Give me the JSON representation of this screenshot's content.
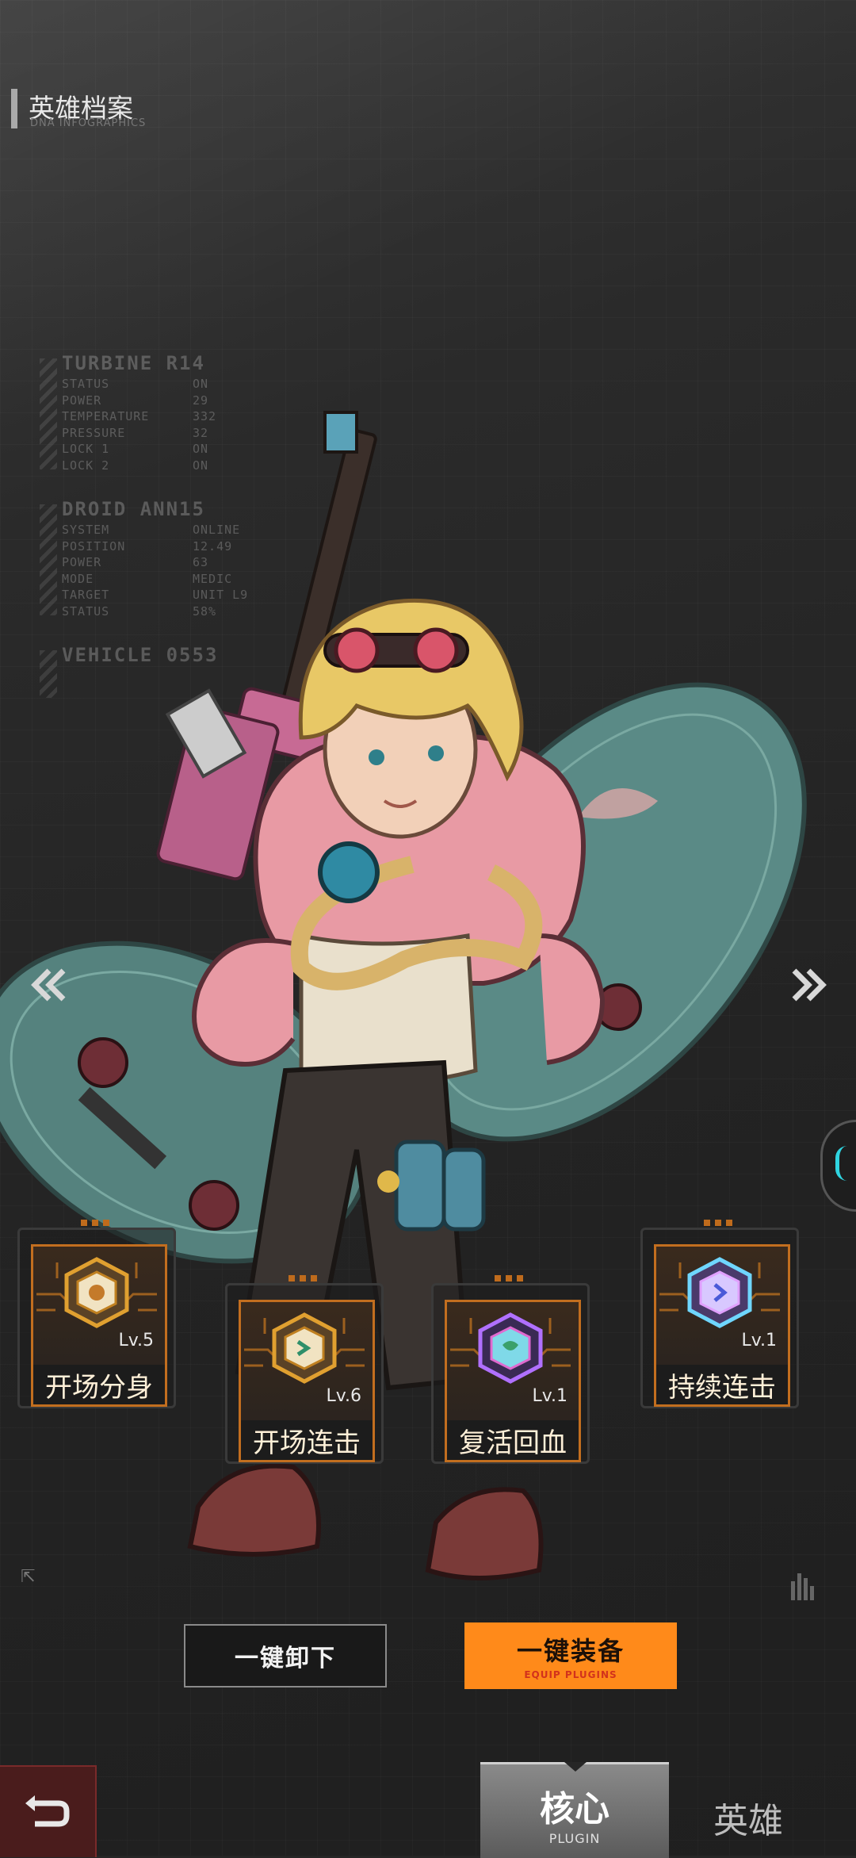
{
  "header": {
    "title": "英雄档案",
    "subtitle": "DNA INFOGRAPHICS"
  },
  "infographics": [
    {
      "heading": "TURBINE R14",
      "rows": [
        {
          "key": "STATUS",
          "value": "ON"
        },
        {
          "key": "POWER",
          "value": "29"
        },
        {
          "key": "TEMPERATURE",
          "value": "332"
        },
        {
          "key": "PRESSURE",
          "value": "32"
        },
        {
          "key": "LOCK 1",
          "value": "ON"
        },
        {
          "key": "LOCK 2",
          "value": "ON"
        }
      ]
    },
    {
      "heading": "DROID ANN15",
      "rows": [
        {
          "key": "SYSTEM",
          "value": "ONLINE"
        },
        {
          "key": "POSITION",
          "value": "12.49"
        },
        {
          "key": "POWER",
          "value": "63"
        },
        {
          "key": "MODE",
          "value": "MEDIC"
        },
        {
          "key": "TARGET",
          "value": "UNIT L9"
        },
        {
          "key": "STATUS",
          "value": "58%"
        }
      ]
    },
    {
      "heading": "VEHICLE 0553",
      "rows": []
    }
  ],
  "nav": {
    "prev_icon": "double-chevron-left-icon",
    "next_icon": "double-chevron-right-icon"
  },
  "plugins": [
    {
      "name": "开场分身",
      "level": "Lv.5",
      "badge_color": "#e0a030"
    },
    {
      "name": "开场连击",
      "level": "Lv.6",
      "badge_color": "#e0a030"
    },
    {
      "name": "复活回血",
      "level": "Lv.1",
      "badge_color": "#b070ff"
    },
    {
      "name": "持续连击",
      "level": "Lv.1",
      "badge_color": "#6fd6ff"
    }
  ],
  "actions": {
    "unequip_label": "一键卸下",
    "equip_label": "一键装备",
    "equip_sublabel": "EQUIP PLUGINS"
  },
  "bottom_nav": {
    "back_icon": "return-arrow-icon",
    "core_label": "核心",
    "core_sublabel": "PLUGIN",
    "hero_label": "英雄"
  },
  "colors": {
    "accent_orange": "#ff8a1a",
    "card_border": "#c26e1f",
    "back_button": "#4a1c1c",
    "side_handle": "#2fd4e0"
  }
}
